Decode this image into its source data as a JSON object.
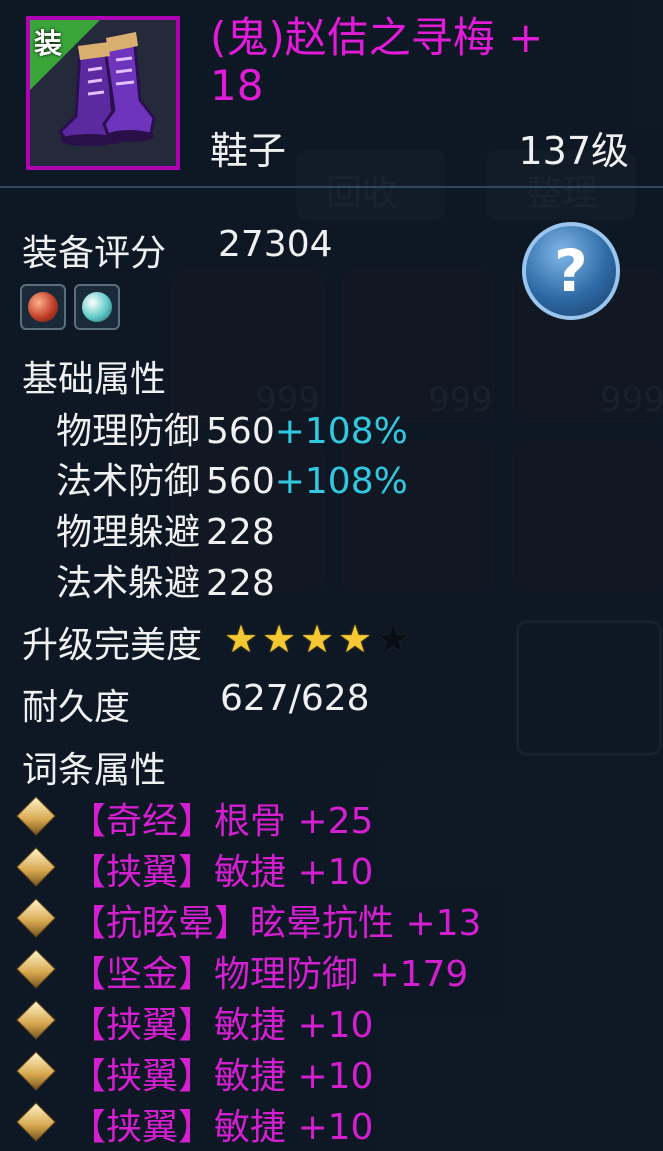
{
  "item": {
    "name": "(鬼)赵佶之寻梅 + 18",
    "type": "鞋子",
    "level": "137级",
    "equip_badge": "装",
    "border_color": "#b000b5",
    "name_color": "#e11bd8"
  },
  "score": {
    "label": "装备评分",
    "value": "27304"
  },
  "help_button": {
    "label": "?"
  },
  "gems": [
    {
      "name": "red-gem-icon",
      "color": "#c0402a"
    },
    {
      "name": "cyan-gem-icon",
      "color": "#5fc8c8"
    }
  ],
  "base_attrs": {
    "heading": "基础属性",
    "rows": [
      {
        "label": "物理防御",
        "value": "560",
        "bonus": "+108%"
      },
      {
        "label": "法术防御",
        "value": "560",
        "bonus": "+108%"
      },
      {
        "label": "物理躲避",
        "value": "228",
        "bonus": ""
      },
      {
        "label": "法术躲避",
        "value": "228",
        "bonus": ""
      }
    ]
  },
  "perfection": {
    "label": "升级完美度",
    "stars_filled": 4,
    "stars_total": 5,
    "star": "★"
  },
  "durability": {
    "label": "耐久度",
    "value": "627/628"
  },
  "affixes": {
    "heading": "词条属性",
    "rows": [
      "【奇经】根骨 +25",
      "【挟翼】敏捷 +10",
      "【抗眩晕】眩晕抗性 +13",
      "【坚金】物理防御 +179",
      "【挟翼】敏捷 +10",
      "【挟翼】敏捷 +10",
      "【挟翼】敏捷 +10"
    ],
    "color": "#d41fd0"
  },
  "background": {
    "buttons": [
      "回收",
      "整理"
    ],
    "counts": [
      "999",
      "999",
      "999"
    ]
  }
}
